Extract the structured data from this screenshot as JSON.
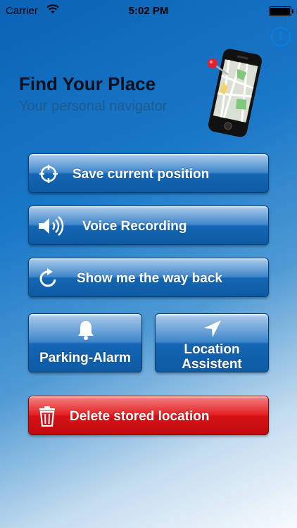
{
  "status_bar": {
    "carrier": "Carrier",
    "time": "5:02 PM"
  },
  "header": {
    "title": "Find Your Place",
    "subtitle": "Your personal navigator"
  },
  "buttons": {
    "save_position": "Save current position",
    "voice_recording": "Voice Recording",
    "show_way_back": "Show me the way back",
    "parking_alarm": "Parking-Alarm",
    "location_assistent": "Location Assistent",
    "delete_location": "Delete stored location"
  },
  "icons": {
    "info": "info-icon",
    "save": "crosshair-icon",
    "voice": "speaker-icon",
    "back": "refresh-arrow-icon",
    "alarm": "bell-icon",
    "location": "location-arrow-icon",
    "delete": "trash-icon"
  },
  "colors": {
    "accent": "#0a7fe0",
    "button_blue": "#1466b3",
    "button_red": "#e42125"
  }
}
